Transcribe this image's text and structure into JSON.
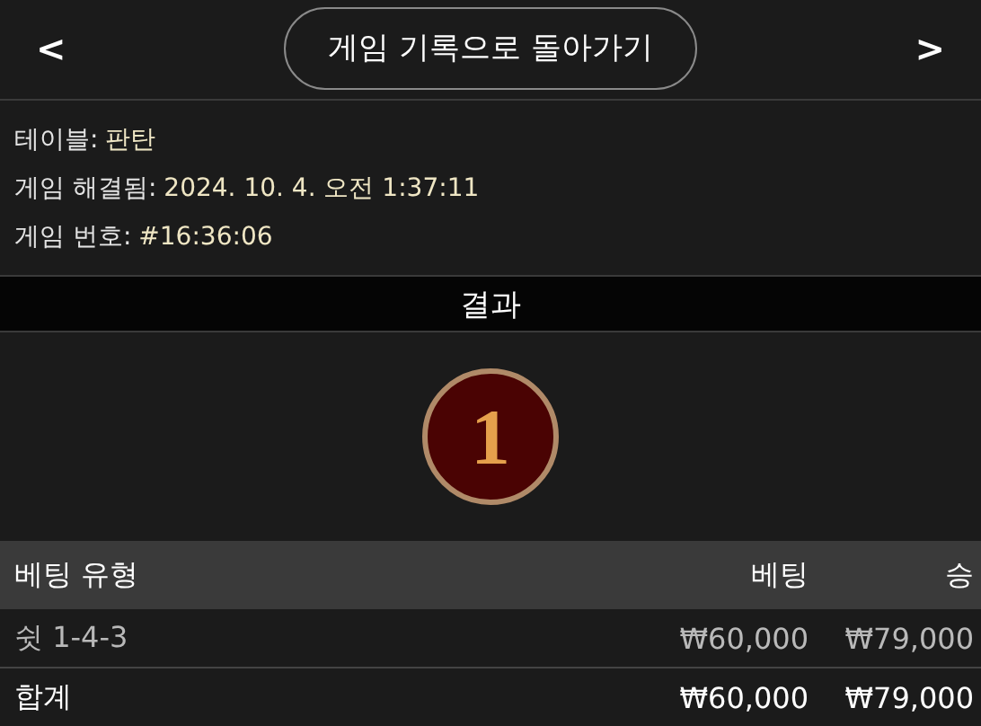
{
  "header": {
    "prev": "<",
    "title": "게임 기록으로 돌아가기",
    "next": ">"
  },
  "info": [
    {
      "label": "테이블:",
      "value": "판탄"
    },
    {
      "label": "게임 해결됨:",
      "value": "2024. 10. 4. 오전 1:37:11"
    },
    {
      "label": "게임 번호:",
      "value": "#16:36:06"
    }
  ],
  "result": {
    "title": "결과",
    "number": "1"
  },
  "table": {
    "columns": [
      "베팅 유형",
      "베팅",
      "승"
    ],
    "rows": [
      {
        "kind": "bet",
        "cells": [
          "쉿 1-4-3",
          "₩60,000",
          "₩79,000"
        ]
      },
      {
        "kind": "total",
        "cells": [
          "합계",
          "₩60,000",
          "₩79,000"
        ]
      }
    ]
  }
}
